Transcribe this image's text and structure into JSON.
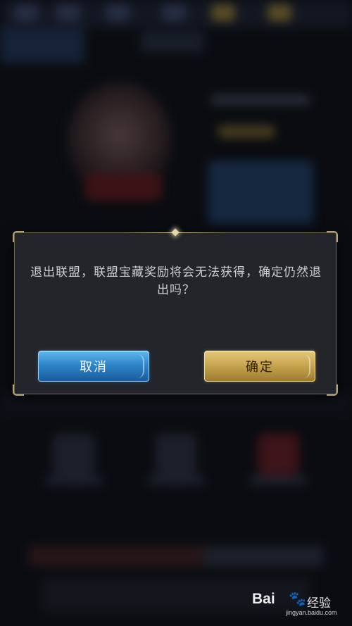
{
  "dialog": {
    "message": "退出联盟，联盟宝藏奖励将会无法获得，确定仍然退出吗？",
    "cancel_label": "取消",
    "confirm_label": "确定"
  },
  "watermark": {
    "logo_text": "Bai",
    "logo_suffix": "经验",
    "url": "jingyan.baidu.com"
  },
  "colors": {
    "cancel_button": "#2f86c9",
    "confirm_button": "#c9a751",
    "dialog_background": "#23252a",
    "dialog_border": "#b5a47a"
  }
}
